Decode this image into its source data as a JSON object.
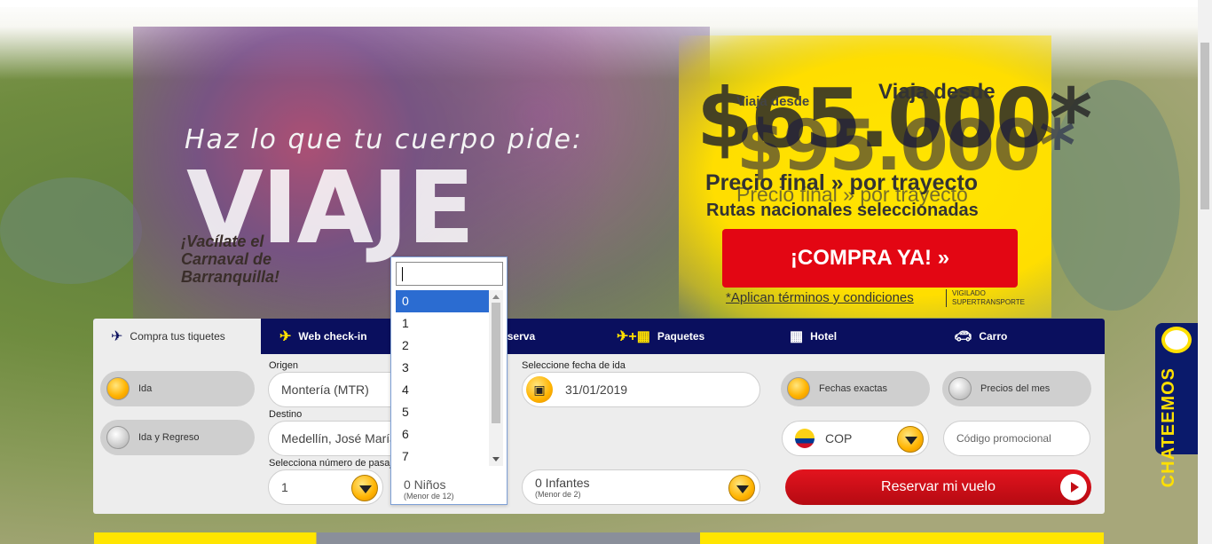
{
  "hero": {
    "tagline": "Haz lo que tu cuerpo pide:",
    "big_word": "VIAJE",
    "subtitle": "¡Vacílate el Carnaval de Barranquilla!"
  },
  "promo": {
    "viaja_desde_small": "Viaja desde",
    "viaja_desde_big": "Viaja desde",
    "price": "$95.000*",
    "price_shadow": "$65.000*",
    "precio_final": "Precio final » por trayecto",
    "precio_final_shadow": "Precio final » por trayecto",
    "rutas": "Rutas nacionales seleccionadas",
    "cta": "¡COMPRA YA!  »",
    "terms": "*Aplican términos y condiciones",
    "vigilado": "VIGILADO SUPERTRANSPORTE"
  },
  "chat": {
    "label": "CHATEEMOS"
  },
  "tabs": [
    {
      "label": "Compra tus tiquetes",
      "icon": "plane-icon"
    },
    {
      "label": "Web check-in",
      "icon": "plane-icon"
    },
    {
      "label": "Reserva",
      "icon": "plane-icon"
    },
    {
      "label": "Paquetes",
      "icon": "plane-hotel-icon"
    },
    {
      "label": "Hotel",
      "icon": "building-icon"
    },
    {
      "label": "Carro",
      "icon": "car-icon"
    }
  ],
  "trip_type": {
    "ida": "Ida",
    "ida_regreso": "Ida y Regreso",
    "selected": "Ida"
  },
  "origin": {
    "label": "Origen",
    "value": "Montería (MTR)"
  },
  "destination": {
    "label": "Destino",
    "value": "Medellín, José María"
  },
  "passengers": {
    "label": "Selecciona número de pasajeros",
    "value": "1"
  },
  "date": {
    "label": "Seleccione fecha de ida",
    "value": "31/01/2019"
  },
  "date_mode": {
    "exact": "Fechas exactas",
    "month": "Precios del mes",
    "selected": "Fechas exactas"
  },
  "currency": {
    "value": "COP"
  },
  "promo_code": {
    "placeholder": "Código promocional"
  },
  "children": {
    "value": "0 Niños",
    "note": "(Menor de 12)"
  },
  "infants": {
    "value": "0 Infantes",
    "note": "(Menor de 2)"
  },
  "submit": "Reservar mi vuelo",
  "dropdown": {
    "search_value": "",
    "options": [
      "0",
      "1",
      "2",
      "3",
      "4",
      "5",
      "6",
      "7"
    ],
    "selected": "0"
  },
  "colors": {
    "navy": "#0a0f5e",
    "yellow": "#ffe000",
    "red": "#e30613"
  }
}
